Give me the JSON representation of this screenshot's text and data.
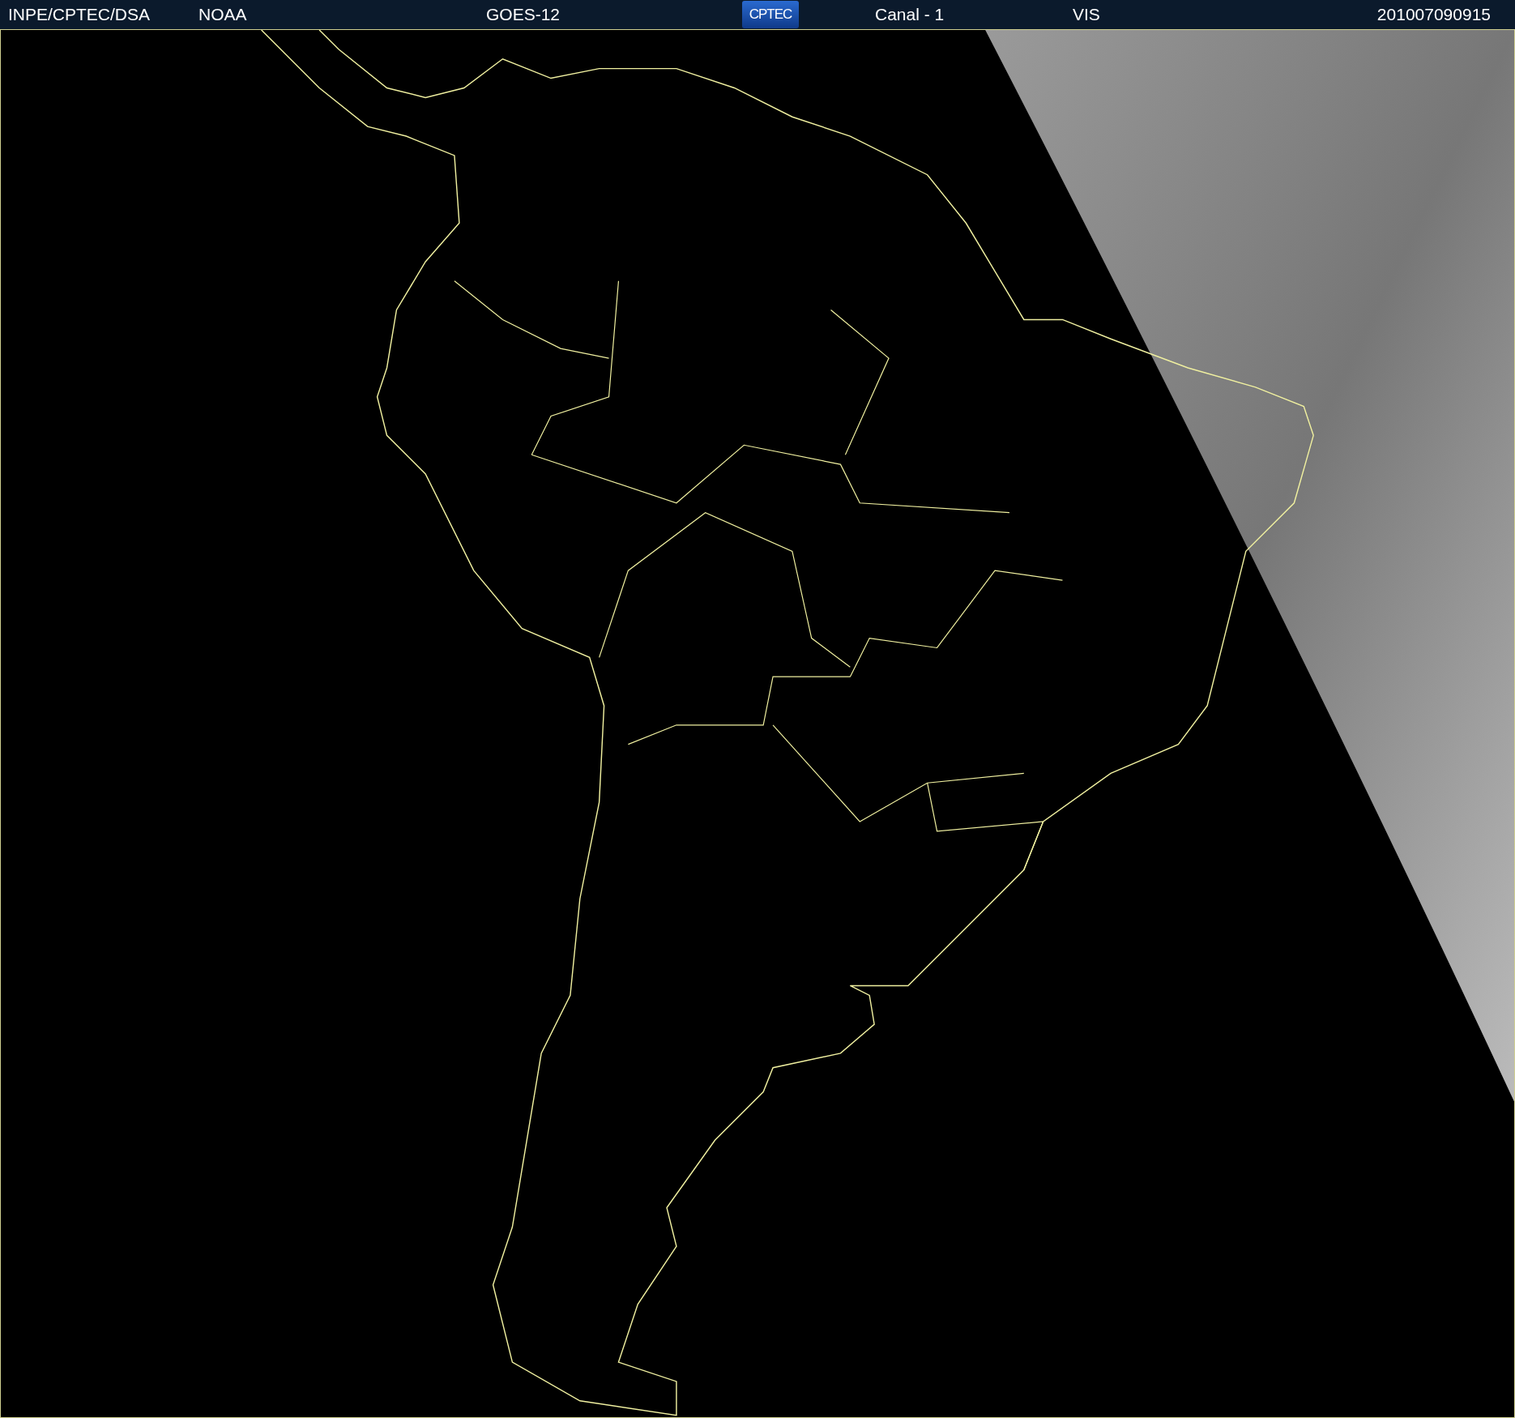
{
  "header": {
    "items": [
      {
        "kind": "text",
        "text": "INPE/CPTEC/DSA"
      },
      {
        "kind": "text",
        "text": "NOAA"
      },
      {
        "kind": "text",
        "text": "GOES-12"
      },
      {
        "kind": "logo",
        "text": "CPTEC"
      },
      {
        "kind": "text",
        "text": "Canal - 1"
      },
      {
        "kind": "text",
        "text": "VIS"
      },
      {
        "kind": "text",
        "text": "201007090915"
      }
    ]
  }
}
